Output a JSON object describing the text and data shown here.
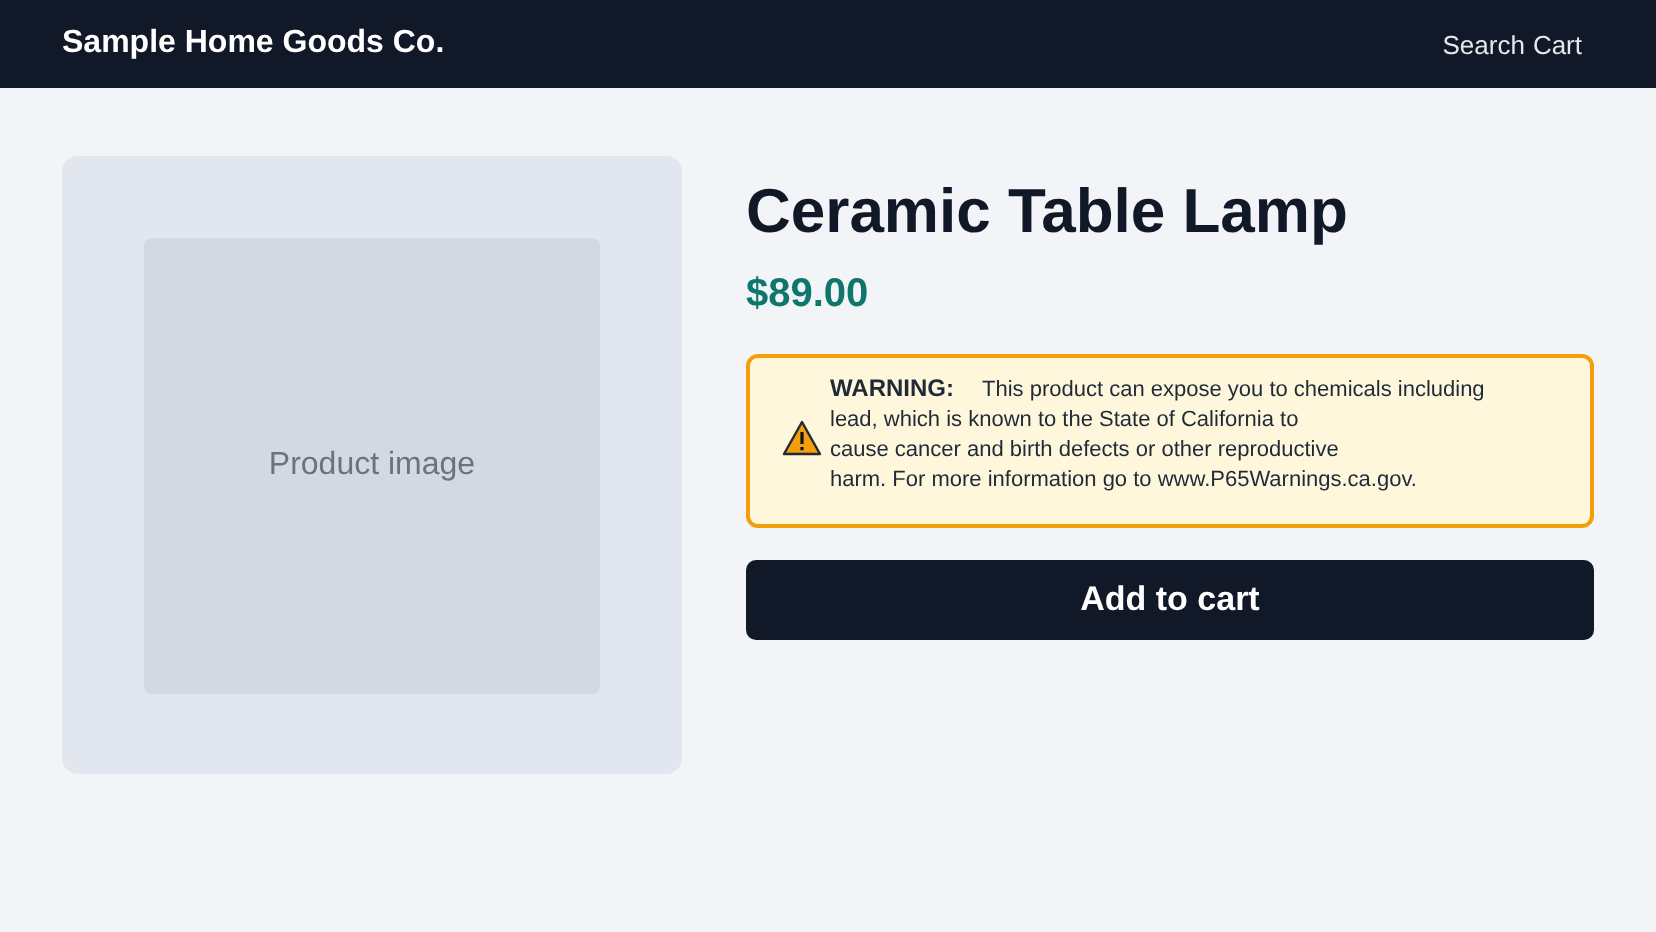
{
  "header": {
    "brand": "Sample Home Goods Co.",
    "nav": [
      {
        "label": "Search"
      },
      {
        "label": "Cart"
      }
    ]
  },
  "product": {
    "image": {
      "caption": "Product image"
    },
    "title": "Ceramic Table Lamp",
    "price": "$89.00",
    "warning": {
      "label": "WARNING:",
      "lines": [
        "This product can expose you to chemicals including",
        "lead, which is known to the State of California to",
        "cause cancer and birth defects or other reproductive",
        "harm. For more information go to www.P65Warnings.ca.gov."
      ]
    },
    "button": "Add to cart"
  }
}
